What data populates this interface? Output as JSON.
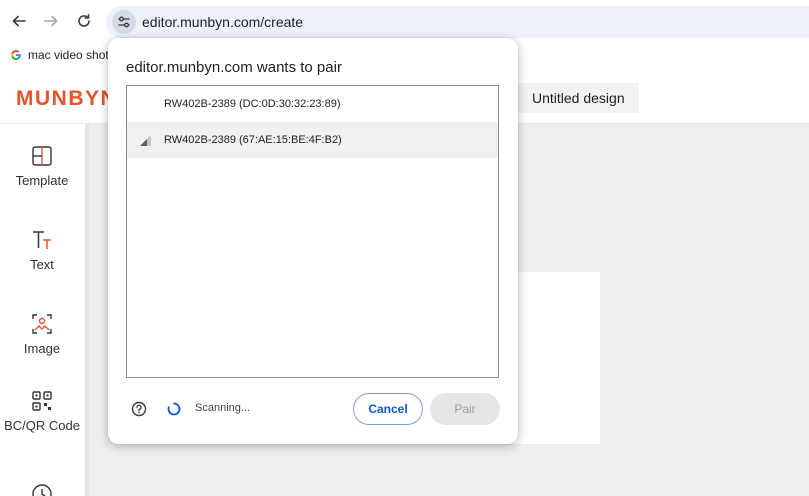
{
  "browser": {
    "url": "editor.munbyn.com/create",
    "bookmark_label": "mac video shot"
  },
  "app": {
    "logo_text": "MUNBYN",
    "design_title": "Untitled design",
    "brand_color": "#e8542a"
  },
  "sidebar": {
    "items": [
      {
        "label": "Template",
        "icon": "template-icon"
      },
      {
        "label": "Text",
        "icon": "text-icon"
      },
      {
        "label": "Image",
        "icon": "image-icon"
      },
      {
        "label": "BC/QR Code",
        "icon": "qr-code-icon"
      },
      {
        "label": "",
        "icon": "clock-icon"
      }
    ]
  },
  "dialog": {
    "title": "editor.munbyn.com wants to pair",
    "devices": [
      {
        "name": "RW402B-2389 (DC:0D:30:32:23:89)",
        "selected": false
      },
      {
        "name": "RW402B-2389 (67:AE:15:BE:4F:B2)",
        "selected": true
      }
    ],
    "status_text": "Scanning...",
    "cancel_label": "Cancel",
    "pair_label": "Pair",
    "accent_color": "#0b57d0"
  }
}
